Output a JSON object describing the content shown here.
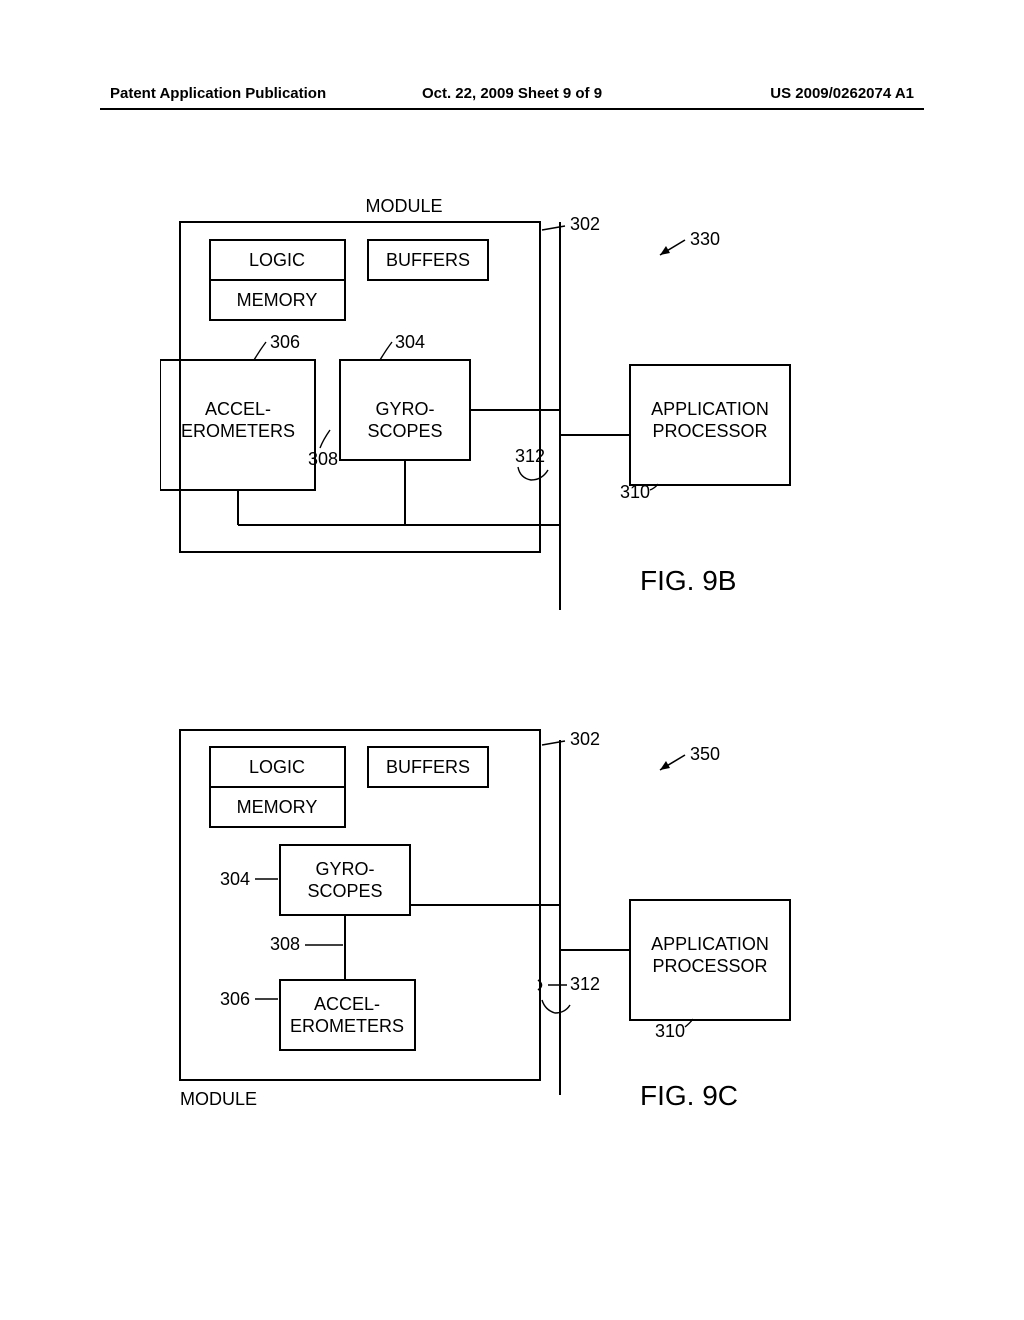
{
  "header": {
    "publication_type": "Patent Application Publication",
    "date_sheet": "Oct. 22, 2009  Sheet 9 of 9",
    "pub_number": "US 2009/0262074 A1"
  },
  "fig9b": {
    "module_label": "MODULE",
    "logic": "LOGIC",
    "memory": "MEMORY",
    "buffers": "BUFFERS",
    "accel_line1": "ACCEL-",
    "accel_line2": "EROMETERS",
    "gyro_line1": "GYRO-",
    "gyro_line2": "SCOPES",
    "app_line1": "APPLICATION",
    "app_line2": "PROCESSOR",
    "ref_302": "302",
    "ref_304": "304",
    "ref_306": "306",
    "ref_308": "308",
    "ref_310": "310",
    "ref_312": "312",
    "ref_330": "330",
    "caption": "FIG. 9B"
  },
  "fig9c": {
    "module_label": "MODULE",
    "logic": "LOGIC",
    "memory": "MEMORY",
    "buffers": "BUFFERS",
    "accel_line1": "ACCEL-",
    "accel_line2": "EROMETERS",
    "gyro_line1": "GYRO-",
    "gyro_line2": "SCOPES",
    "app_line1": "APPLICATION",
    "app_line2": "PROCESSOR",
    "ref_302": "302",
    "ref_304": "304",
    "ref_306": "306",
    "ref_308": "308",
    "ref_310": "310",
    "ref_312": "312",
    "ref_350": "350",
    "caption": "FIG. 9C"
  }
}
